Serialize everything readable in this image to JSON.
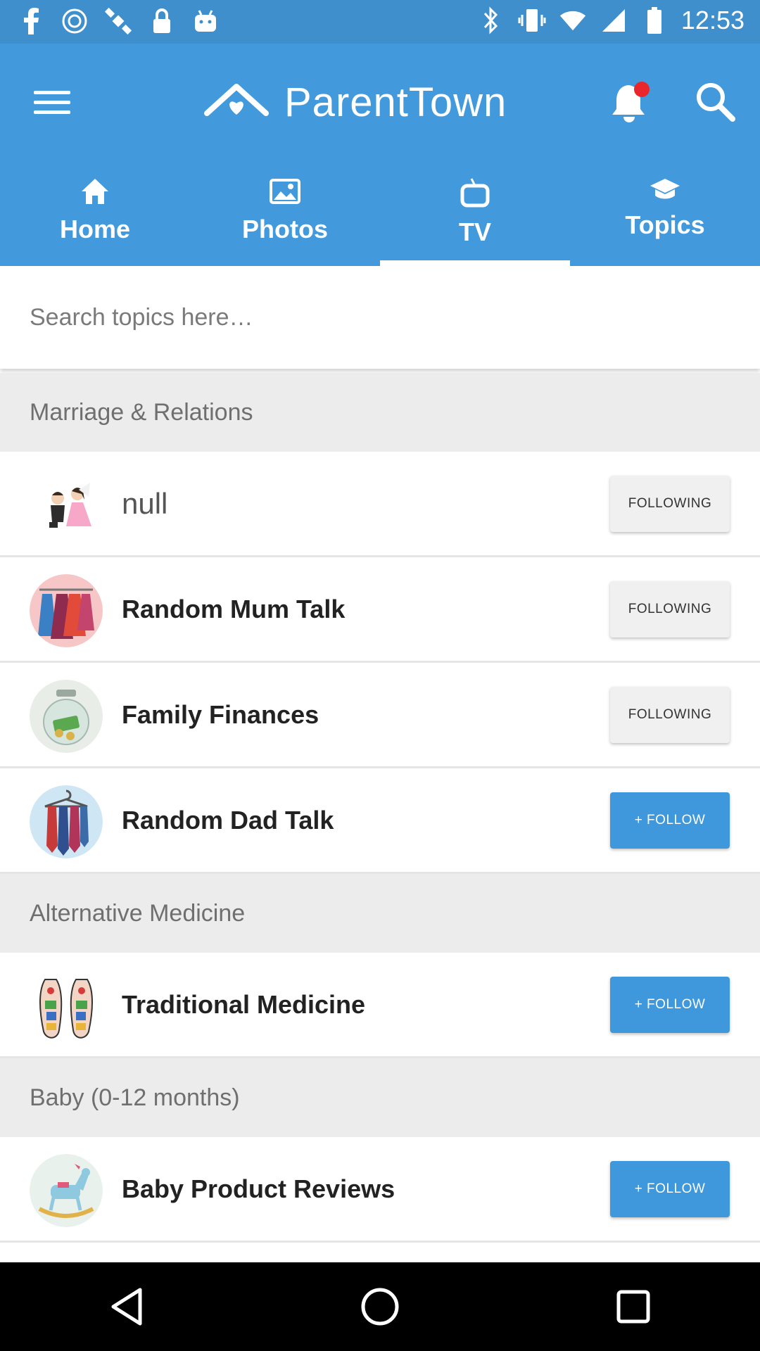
{
  "status_bar": {
    "time": "12:53",
    "left_icons": [
      "facebook-icon",
      "cast-icon",
      "satellite-icon",
      "lock-icon",
      "android-icon"
    ],
    "right_icons": [
      "bluetooth-icon",
      "vibrate-icon",
      "wifi-icon",
      "signal-icon",
      "battery-icon"
    ]
  },
  "app_bar": {
    "title": "ParentTown",
    "menu_icon": "hamburger-menu-icon",
    "notification_icon": "bell-icon",
    "notification_dot_color": "#e8262b",
    "search_icon": "search-icon",
    "background_color": "#4299dc"
  },
  "tabs": [
    {
      "label": "Home",
      "icon": "home-icon",
      "active": false
    },
    {
      "label": "Photos",
      "icon": "photos-icon",
      "active": false
    },
    {
      "label": "TV",
      "icon": "tv-icon",
      "active": true
    },
    {
      "label": "Topics",
      "icon": "graduation-cap-icon",
      "active": false
    }
  ],
  "search": {
    "placeholder": "Search topics here…",
    "value": ""
  },
  "sections": [
    {
      "title": "Marriage & Relations",
      "items": [
        {
          "title": "null",
          "button": "FOLLOWING",
          "following": true,
          "avatar": "couple-avatar"
        },
        {
          "title": "Random Mum Talk",
          "button": "FOLLOWING",
          "following": true,
          "avatar": "dresses-avatar"
        },
        {
          "title": "Family Finances",
          "button": "FOLLOWING",
          "following": true,
          "avatar": "money-jar-avatar"
        },
        {
          "title": "Random Dad Talk",
          "button": "+ FOLLOW",
          "following": false,
          "avatar": "ties-avatar"
        }
      ]
    },
    {
      "title": "Alternative Medicine",
      "items": [
        {
          "title": "Traditional Medicine",
          "button": "+ FOLLOW",
          "following": false,
          "avatar": "reflexology-feet-avatar"
        }
      ]
    },
    {
      "title": "Baby (0-12 months)",
      "items": [
        {
          "title": "Baby Product Reviews",
          "button": "+ FOLLOW",
          "following": false,
          "avatar": "rocking-horse-avatar"
        }
      ]
    }
  ],
  "nav_bar": {
    "buttons": [
      "back-icon",
      "home-circle-icon",
      "recents-square-icon"
    ]
  }
}
